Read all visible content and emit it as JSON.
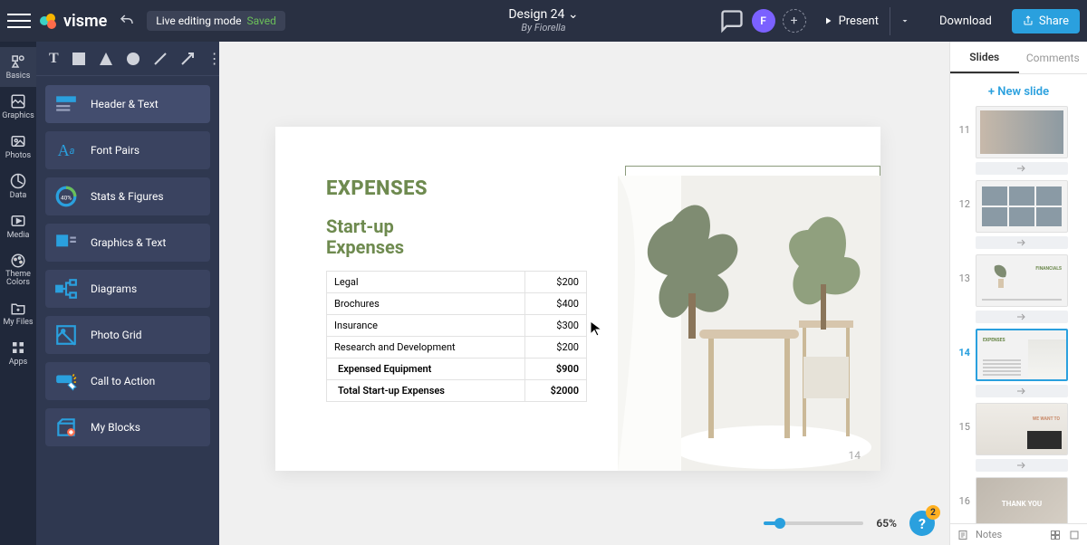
{
  "topbar": {
    "brand": "visme",
    "editing_mode": "Live editing mode",
    "saved": "Saved",
    "title": "Design 24",
    "byline": "By Fiorella",
    "avatar_initial": "F",
    "present": "Present",
    "download": "Download",
    "share": "Share"
  },
  "rail": {
    "items": [
      {
        "label": "Basics"
      },
      {
        "label": "Graphics"
      },
      {
        "label": "Photos"
      },
      {
        "label": "Data"
      },
      {
        "label": "Media"
      },
      {
        "label": "Theme Colors"
      },
      {
        "label": "My Files"
      },
      {
        "label": "Apps"
      }
    ]
  },
  "panel": {
    "items": [
      {
        "label": "Header & Text"
      },
      {
        "label": "Font Pairs"
      },
      {
        "label": "Stats & Figures"
      },
      {
        "label": "Graphics & Text"
      },
      {
        "label": "Diagrams"
      },
      {
        "label": "Photo Grid"
      },
      {
        "label": "Call to Action"
      },
      {
        "label": "My Blocks"
      }
    ]
  },
  "slide": {
    "heading": "EXPENSES",
    "subheading_l1": "Start-up",
    "subheading_l2": "Expenses",
    "number": "14",
    "rows": [
      {
        "label": "Legal",
        "value": "$200"
      },
      {
        "label": "Brochures",
        "value": "$400"
      },
      {
        "label": "Insurance",
        "value": "$300"
      },
      {
        "label": "Research and Development",
        "value": "$200"
      },
      {
        "label": "Expensed Equipment",
        "value": "$900"
      },
      {
        "label": "Total Start-up Expenses",
        "value": "$2000"
      }
    ]
  },
  "zoom": {
    "pct": "65%",
    "help_badge": "2"
  },
  "right": {
    "tab_slides": "Slides",
    "tab_comments": "Comments",
    "new_slide": "+ New slide",
    "thumbs": [
      {
        "n": "11"
      },
      {
        "n": "12"
      },
      {
        "n": "13"
      },
      {
        "n": "14"
      },
      {
        "n": "15"
      },
      {
        "n": "16"
      }
    ],
    "thank_you": "THANK YOU",
    "financials": "FINANCIALS",
    "we_want": "WE WANT TO",
    "expenses_mini": "EXPENSES",
    "notes": "Notes"
  }
}
